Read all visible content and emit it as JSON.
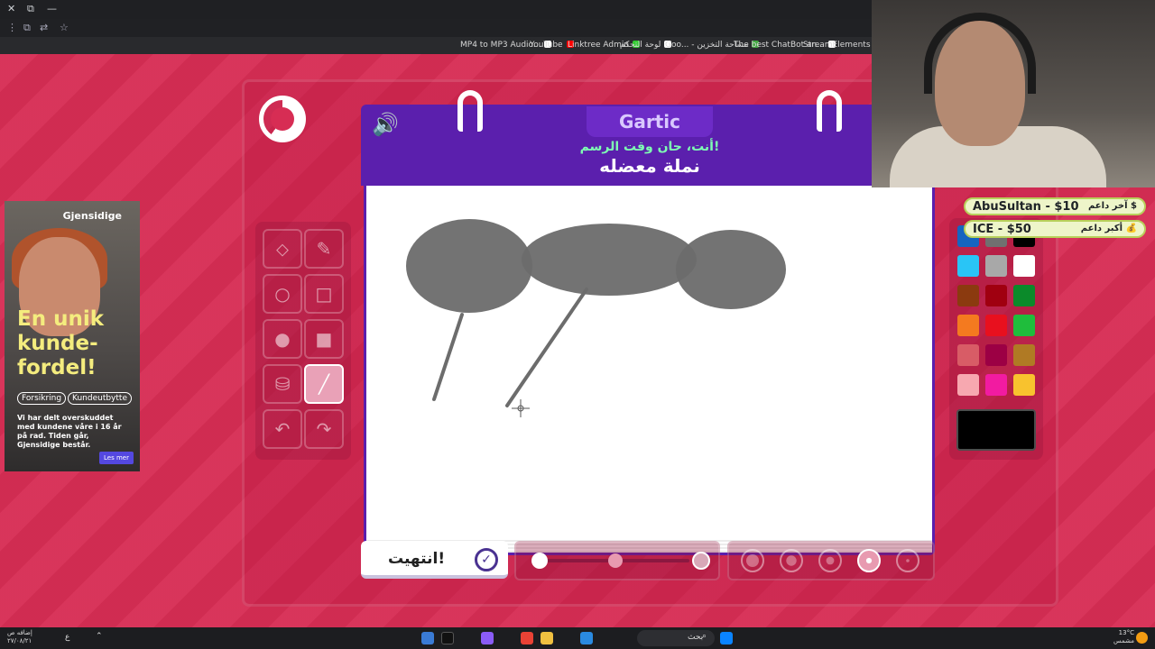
{
  "browser": {
    "bookmarks": [
      "MP4 to MP3 Audio...",
      "YouTube",
      "Linktree Admin",
      "لوحة التحكم",
      "Goo... - مساحة التخزين",
      "The best ChatBot an...",
      "StreamElements | T..."
    ]
  },
  "game": {
    "logo": "Gartic",
    "subtitle": "أنت، حان وقت الرسم!",
    "word": "نملة معضله",
    "done_label": "انتهيت!",
    "tools": [
      "eraser-icon",
      "pencil-icon",
      "circle-outline-icon",
      "square-outline-icon",
      "circle-fill-icon",
      "square-fill-icon",
      "fill-bucket-icon",
      "line-icon",
      "undo-icon",
      "redo-icon"
    ],
    "active_tool": "line-icon",
    "palette": [
      "#1565c0",
      "#707070",
      "#000000",
      "#29c5f6",
      "#a8a8a8",
      "#ffffff",
      "#8b3a0f",
      "#a00010",
      "#0b8a2a",
      "#f47a1f",
      "#e8101e",
      "#1fbd3c",
      "#d85c66",
      "#9c0044",
      "#b07a24",
      "#f7a8b0",
      "#f21ba1",
      "#f8c22e"
    ],
    "current_color": "#000000",
    "opacity_level": 0.5,
    "selected_size_index": 3,
    "sizes": 5
  },
  "donations": {
    "last": {
      "label": "آخر داعم $",
      "value": "AbuSultan - $10"
    },
    "top": {
      "label": "أكبر داعم 💰",
      "value": "ICE - $50"
    }
  },
  "ad": {
    "brand": "Gjensidige",
    "headline": "En unik kunde-fordel!",
    "pills": [
      "Forsikring",
      "Kundeutbytte"
    ],
    "body": "Vi har delt overskuddet med kundene våre i 16 år på rad. Tiden går, Gjensidige består.",
    "cta": "Les mer"
  },
  "taskbar": {
    "search": "بحث",
    "weather": "13°C",
    "weather_desc": "مشمس",
    "time": "إضافه ص",
    "date": "٢٧/٠٨/٢١"
  }
}
